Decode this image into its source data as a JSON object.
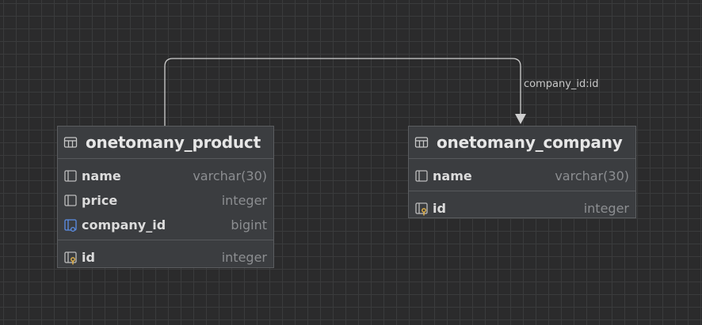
{
  "relationship": {
    "label": "company_id:id",
    "line_color": "#cfcfcf"
  },
  "entities": [
    {
      "title": "onetomany_product",
      "icon": "table-icon",
      "sections": [
        [
          {
            "name": "name",
            "type": "varchar(30)",
            "icon": "column-icon"
          },
          {
            "name": "price",
            "type": "integer",
            "icon": "column-icon"
          },
          {
            "name": "company_id",
            "type": "bigint",
            "icon": "foreign-key-column-icon"
          }
        ],
        [
          {
            "name": "id",
            "type": "integer",
            "icon": "primary-key-column-icon"
          }
        ]
      ]
    },
    {
      "title": "onetomany_company",
      "icon": "table-icon",
      "sections": [
        [
          {
            "name": "name",
            "type": "varchar(30)",
            "icon": "column-icon"
          }
        ],
        [
          {
            "name": "id",
            "type": "integer",
            "icon": "primary-key-column-icon"
          }
        ]
      ]
    }
  ],
  "colors": {
    "canvas_background": "#2b2b2c",
    "grid_line": "#3a3b3c",
    "entity_background": "#3b3d40",
    "foreign_key_accent": "#5b8ee6",
    "primary_key_accent": "#e6b54a"
  }
}
